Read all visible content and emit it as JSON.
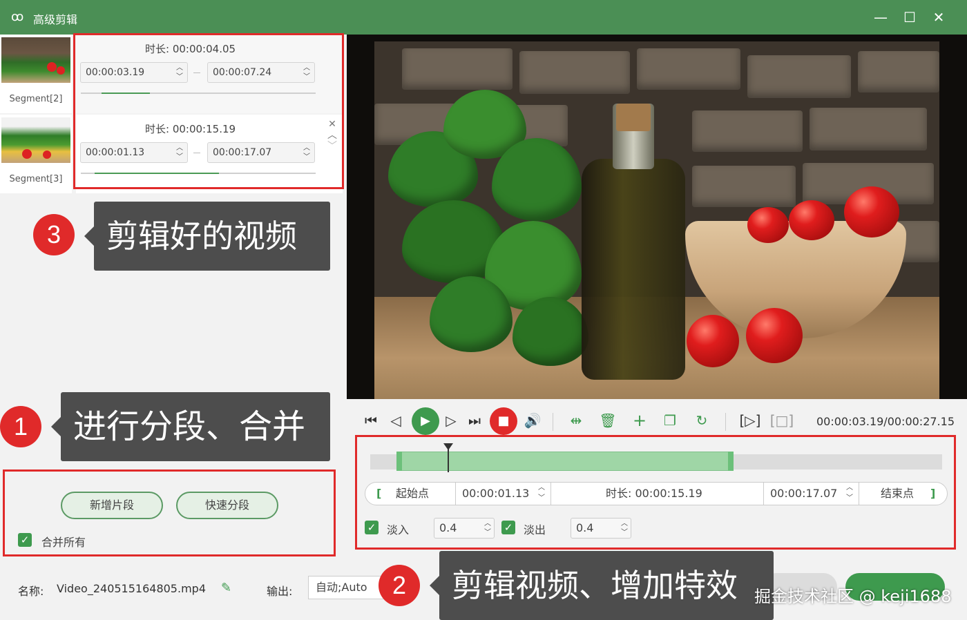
{
  "window": {
    "title": "高级剪辑",
    "minimize": "—",
    "maximize": "☐",
    "close": "✕"
  },
  "segments": [
    {
      "label": "Segment[2]",
      "duration": "时长: 00:00:04.05",
      "start": "00:00:03.19",
      "end": "00:00:07.24"
    },
    {
      "label": "Segment[3]",
      "duration": "时长: 00:00:15.19",
      "start": "00:00:01.13",
      "end": "00:00:17.07"
    }
  ],
  "annotations": {
    "step3_num": "3",
    "step3": "剪辑好的视频",
    "step1_num": "1",
    "step1": "进行分段、合并",
    "step2_num": "2",
    "step2": "剪辑视频、增加特效"
  },
  "left_actions": {
    "add_segment": "新增片段",
    "quick_segment": "快速分段",
    "merge_all": "合并所有"
  },
  "player": {
    "timecode": "00:00:03.19/00:00:27.15",
    "playhead_fraction": 0.135,
    "selection_start_fraction": 0.05,
    "selection_end_fraction": 0.635
  },
  "range": {
    "start_label": "起始点",
    "start_value": "00:00:01.13",
    "duration": "时长: 00:00:15.19",
    "end_value": "00:00:17.07",
    "end_label": "结束点",
    "bracket_open": "[",
    "bracket_close": "]"
  },
  "effects": {
    "fade_in_label": "淡入",
    "fade_in_value": "0.4",
    "fade_out_label": "淡出",
    "fade_out_value": "0.4"
  },
  "bottom": {
    "name_label": "名称:",
    "name_value": "Video_240515164805.mp4",
    "output_label": "输出:",
    "output_value": "自动;Auto",
    "watermark": "掘金技术社区 @ keji1688"
  },
  "colors": {
    "accent": "#4b8f55",
    "annotation_red": "#e02a2a",
    "callout_bg": "#4d4d4d"
  }
}
